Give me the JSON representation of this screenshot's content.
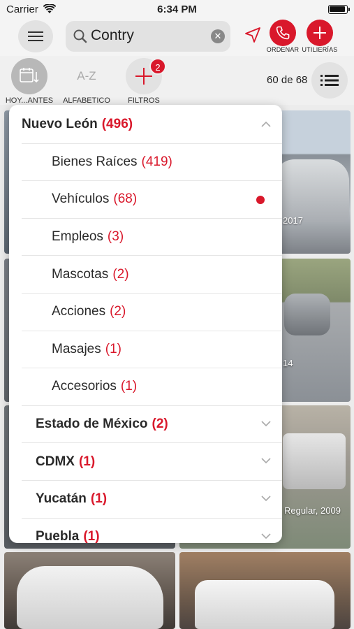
{
  "status_bar": {
    "carrier": "Carrier",
    "time": "6:34 PM"
  },
  "header": {
    "search_value": "Contry",
    "order_label": "ORDENAR",
    "utilities_label": "UTILIERÍAS"
  },
  "toolbar": {
    "sort_date_label": "HOY...ANTES",
    "sort_alpha_glyph": "A-Z",
    "sort_alpha_label": "ALFABETICO",
    "filters_label": "FILTROS",
    "filters_badge": "2",
    "result_count": "60 de 68"
  },
  "background_captions": {
    "car1_year": "2017",
    "car2_year": "14",
    "truck_caption": "Regular, 2009"
  },
  "filter_menu": {
    "state_expanded": {
      "name": "Nuevo León",
      "count": "(496)"
    },
    "categories": [
      {
        "name": "Bienes Raíces",
        "count": "(419)",
        "selected": false
      },
      {
        "name": "Vehículos",
        "count": "(68)",
        "selected": true
      },
      {
        "name": "Empleos",
        "count": "(3)",
        "selected": false
      },
      {
        "name": "Mascotas",
        "count": "(2)",
        "selected": false
      },
      {
        "name": "Acciones",
        "count": "(2)",
        "selected": false
      },
      {
        "name": "Masajes",
        "count": "(1)",
        "selected": false
      },
      {
        "name": "Accesorios",
        "count": "(1)",
        "selected": false
      }
    ],
    "other_states": [
      {
        "name": "Estado de México",
        "count": "(2)"
      },
      {
        "name": "CDMX",
        "count": "(1)"
      },
      {
        "name": "Yucatán",
        "count": "(1)"
      },
      {
        "name": "Puebla",
        "count": "(1)"
      }
    ]
  },
  "colors": {
    "accent": "#d9182b",
    "panel": "#ffffff",
    "background": "#ececec"
  },
  "icons": [
    "wifi-icon",
    "battery-icon",
    "hamburger-icon",
    "search-icon",
    "clear-icon",
    "location-arrow-icon",
    "phone-icon",
    "plus-icon",
    "calendar-icon",
    "list-icon",
    "chevron-up-icon",
    "chevron-down-icon"
  ]
}
